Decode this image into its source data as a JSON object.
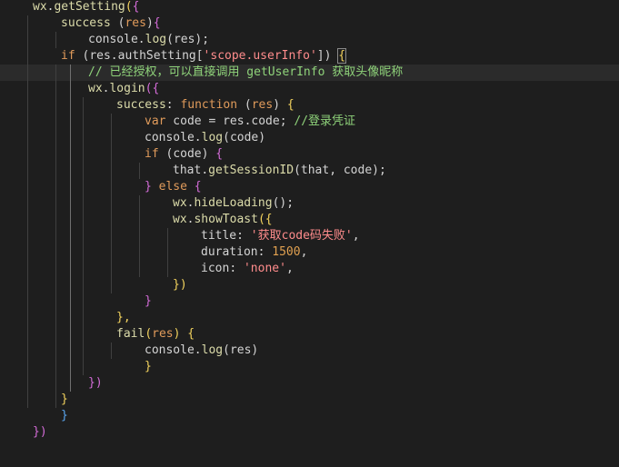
{
  "editor": {
    "language": "javascript",
    "highlighted_line": 4,
    "lines": [
      {
        "indent": 0,
        "tokens": [
          [
            "wx",
            "t-ident"
          ],
          [
            ".",
            "t-punct"
          ],
          [
            "getSetting",
            "t-call"
          ],
          [
            "(",
            "t-bracket1"
          ],
          [
            "{",
            "t-bracket2"
          ]
        ]
      },
      {
        "indent": 1,
        "tokens": [
          [
            "success",
            "t-call"
          ],
          [
            " (",
            "t-punct"
          ],
          [
            "res",
            "t-keyword"
          ],
          ")",
          "t-punct"
        ]
      },
      {
        "indent": 2,
        "tokens": [
          [
            "console",
            "t-prop"
          ],
          [
            ".",
            "t-punct"
          ],
          [
            "log",
            "t-call"
          ],
          [
            "(",
            "t-punct"
          ],
          [
            "res",
            "t-prop"
          ],
          [
            ");",
            "t-punct"
          ]
        ]
      },
      {
        "indent": 1,
        "tokens": [
          [
            "if",
            "t-keyword"
          ],
          [
            " (",
            "t-punct"
          ],
          [
            "res",
            "t-prop"
          ],
          [
            ".",
            "t-punct"
          ],
          [
            "authSetting",
            "t-prop"
          ],
          [
            "[",
            "t-punct"
          ],
          [
            "'scope.userInfo'",
            "t-string"
          ],
          [
            "]",
            "t-punct"
          ],
          [
            ") ",
            "t-punct"
          ],
          [
            "{",
            "t-bracket1"
          ]
        ]
      },
      {
        "indent": 2,
        "tokens": [
          [
            "// 已经授权，可以直接调用 getUserInfo 获取头像昵称",
            "t-comment"
          ]
        ]
      },
      {
        "indent": 2,
        "tokens": [
          [
            "wx",
            "t-ident"
          ],
          [
            ".",
            "t-punct"
          ],
          [
            "login",
            "t-call"
          ],
          [
            "({",
            "t-bracket2"
          ]
        ]
      },
      {
        "indent": 3,
        "tokens": [
          [
            "success",
            "t-call"
          ],
          [
            ": ",
            "t-punct"
          ],
          [
            "function",
            "t-keyword"
          ],
          [
            " (",
            "t-punct"
          ],
          [
            "res",
            "t-keyword"
          ],
          [
            ") ",
            "t-punct"
          ],
          [
            "{",
            "t-bracket1"
          ]
        ]
      },
      {
        "indent": 4,
        "tokens": [
          [
            "var",
            "t-keyword"
          ],
          [
            " code = res.code; ",
            "t-default"
          ],
          [
            "//登录凭证",
            "t-comment"
          ]
        ]
      },
      {
        "indent": 4,
        "tokens": [
          [
            "console",
            "t-prop"
          ],
          [
            ".",
            "t-punct"
          ],
          [
            "log",
            "t-call"
          ],
          [
            "(",
            "t-punct"
          ],
          [
            "code",
            "t-prop"
          ],
          [
            ")",
            "t-punct"
          ]
        ]
      },
      {
        "indent": 4,
        "tokens": [
          [
            "if",
            "t-keyword"
          ],
          [
            " (",
            "t-punct"
          ],
          [
            "code",
            "t-prop"
          ],
          [
            ") ",
            "t-punct"
          ],
          [
            "{",
            "t-bracket2"
          ]
        ]
      },
      {
        "indent": 5,
        "tokens": [
          [
            "that",
            "t-prop"
          ],
          [
            ".",
            "t-punct"
          ],
          [
            "getSessionID",
            "t-call"
          ],
          [
            "(that, code);",
            "t-default"
          ]
        ]
      },
      {
        "indent": 4,
        "tokens": [
          [
            "}",
            "t-bracket2"
          ],
          [
            " else ",
            "t-keyword"
          ],
          [
            "{",
            "t-bracket2"
          ]
        ]
      },
      {
        "indent": 5,
        "tokens": [
          [
            "wx",
            "t-ident"
          ],
          [
            ".",
            "t-punct"
          ],
          [
            "hideLoading",
            "t-call"
          ],
          [
            "();",
            "t-punct"
          ]
        ]
      },
      {
        "indent": 5,
        "tokens": [
          [
            "wx",
            "t-ident"
          ],
          [
            ".",
            "t-punct"
          ],
          [
            "showToast",
            "t-call"
          ],
          [
            "({",
            "t-bracket1"
          ]
        ]
      },
      {
        "indent": 6,
        "tokens": [
          [
            "title",
            "t-prop"
          ],
          [
            ": ",
            "t-punct"
          ],
          [
            "'获取code码失败'",
            "t-string"
          ],
          [
            ",",
            "t-punct"
          ]
        ]
      },
      {
        "indent": 6,
        "tokens": [
          [
            "duration",
            "t-prop"
          ],
          [
            ": ",
            "t-punct"
          ],
          [
            "1500",
            "t-number"
          ],
          [
            ",",
            "t-punct"
          ]
        ]
      },
      {
        "indent": 6,
        "tokens": [
          [
            "icon",
            "t-prop"
          ],
          [
            ": ",
            "t-punct"
          ],
          [
            "'none'",
            "t-string"
          ],
          [
            ",",
            "t-punct"
          ]
        ]
      },
      {
        "indent": 5,
        "tokens": [
          [
            "})",
            "t-bracket1"
          ]
        ]
      },
      {
        "indent": 4,
        "tokens": [
          [
            "}",
            "t-bracket2"
          ]
        ]
      },
      {
        "indent": 3,
        "tokens": [
          [
            "},",
            "t-bracket1"
          ]
        ]
      },
      {
        "indent": 3,
        "tokens": [
          [
            "fail",
            "t-call"
          ],
          [
            "(",
            "t-bracket1"
          ],
          [
            "res",
            "t-keyword"
          ],
          [
            ") ",
            "t-bracket1"
          ],
          [
            "{",
            "t-bracket1"
          ]
        ]
      },
      {
        "indent": 4,
        "tokens": [
          [
            "console",
            "t-prop"
          ],
          [
            ".",
            "t-punct"
          ],
          [
            "log",
            "t-call"
          ],
          [
            "(",
            "t-punct"
          ],
          [
            "res",
            "t-prop"
          ],
          [
            ")",
            "t-punct"
          ]
        ]
      },
      {
        "indent": 4,
        "tokens": [
          [
            "}",
            "t-bracket1"
          ]
        ]
      },
      {
        "indent": 2,
        "tokens": [
          [
            "})",
            "t-bracket2"
          ]
        ]
      },
      {
        "indent": 1,
        "tokens": [
          [
            "}",
            "t-bracket1"
          ]
        ]
      },
      {
        "indent": 1,
        "tokens": [
          [
            "}",
            "t-bracket3"
          ]
        ]
      },
      {
        "indent": 0,
        "tokens": [
          [
            "})",
            "t-bracket2"
          ]
        ]
      }
    ]
  }
}
